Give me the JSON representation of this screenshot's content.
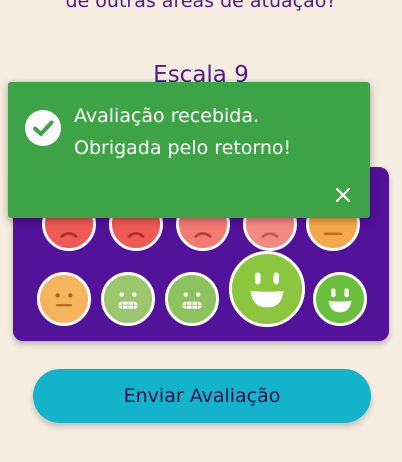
{
  "survey": {
    "question_text": "de outras áreas de atuação?",
    "scale_title": "Escala 9",
    "submit_label": "Enviar Avaliação"
  },
  "toast": {
    "line1": "Avaliação recebida.",
    "line2": "Obrigada pelo retorno!"
  },
  "colors": {
    "background": "#f6ece0",
    "panel": "#53129a",
    "toast": "#3ea346",
    "button": "#13b3cc",
    "text_purple": "#4e1d8e"
  },
  "rating_scale": [
    {
      "mood": "sad",
      "color": "#ef5a55"
    },
    {
      "mood": "sad",
      "color": "#ef5a55"
    },
    {
      "mood": "sad",
      "color": "#f47a72"
    },
    {
      "mood": "sad",
      "color": "#f58a82"
    },
    {
      "mood": "neutral",
      "color": "#f7a84a"
    },
    {
      "mood": "neutral",
      "color": "#f7b45e"
    },
    {
      "mood": "grimace",
      "color": "#9bc66e"
    },
    {
      "mood": "grimace",
      "color": "#8cc35f"
    },
    {
      "mood": "happy",
      "color": "#8cc63e",
      "selected": true
    },
    {
      "mood": "happy",
      "color": "#6abf3e"
    }
  ]
}
